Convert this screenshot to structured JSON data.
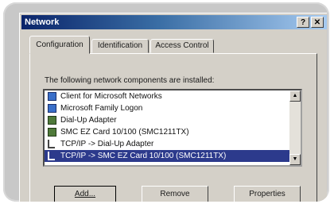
{
  "window": {
    "title": "Network",
    "help_glyph": "?",
    "close_glyph": "✕"
  },
  "tabs": [
    {
      "label": "Configuration"
    },
    {
      "label": "Identification"
    },
    {
      "label": "Access Control"
    }
  ],
  "config": {
    "caption": "The following network components are installed:",
    "components": [
      {
        "label": "Client for Microsoft Networks",
        "icon": "client-icon"
      },
      {
        "label": "Microsoft Family Logon",
        "icon": "client-icon"
      },
      {
        "label": "Dial-Up Adapter",
        "icon": "adapter-icon"
      },
      {
        "label": "SMC EZ Card 10/100 (SMC1211TX)",
        "icon": "adapter-icon"
      },
      {
        "label": "TCP/IP -> Dial-Up Adapter",
        "icon": "protocol-icon"
      },
      {
        "label": "TCP/IP -> SMC EZ Card 10/100 (SMC1211TX)",
        "icon": "protocol-icon",
        "selected": true
      }
    ],
    "scroll_up": "▲",
    "scroll_down": "▼"
  },
  "buttons": {
    "add": "Add...",
    "remove": "Remove",
    "properties": "Properties"
  }
}
